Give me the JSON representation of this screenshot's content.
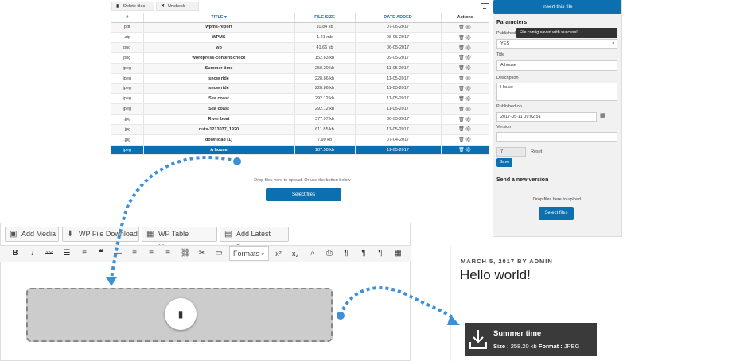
{
  "toolbar": {
    "delete_label": "Delete files",
    "uncheck_label": "Uncheck"
  },
  "table": {
    "headers": [
      "#",
      "TITLE ▾",
      "FILE SIZE",
      "DATE ADDED",
      "Actions"
    ],
    "rows": [
      {
        "ext": "pdf",
        "title": "wpms-report",
        "size": "10.84 kb",
        "date": "07-06-2017"
      },
      {
        "ext": ".zip",
        "title": "WPMS",
        "size": "1.21 mb",
        "date": "08-05-2017"
      },
      {
        "ext": "png",
        "title": "wp",
        "size": "41.66 kb",
        "date": "06-05-2017"
      },
      {
        "ext": "png",
        "title": "wordpress-content-check",
        "size": "152.63 kb",
        "date": "09-05-2017"
      },
      {
        "ext": "jpeg",
        "title": "Summer time",
        "size": "258.20 kb",
        "date": "11-05-2017"
      },
      {
        "ext": "jpeg",
        "title": "snow ride",
        "size": "228.86 kb",
        "date": "11-05-2017"
      },
      {
        "ext": "jpeg",
        "title": "snow ride",
        "size": "228.86 kb",
        "date": "11-05-2017"
      },
      {
        "ext": "jpeg",
        "title": "Sea coast",
        "size": "292.12 kb",
        "date": "11-05-2017"
      },
      {
        "ext": "jpeg",
        "title": "Sea coast",
        "size": "292.12 kb",
        "date": "11-05-2017"
      },
      {
        "ext": ".jpg",
        "title": "River boat",
        "size": "377.97 kb",
        "date": "30-05-2017"
      },
      {
        "ext": ".jpg",
        "title": "nuts-1213037_1920",
        "size": "611.85 kb",
        "date": "11-05-2017"
      },
      {
        "ext": ".jpg",
        "title": "download (1)",
        "size": "7.90 kb",
        "date": "07-04-2017"
      },
      {
        "ext": "jpeg",
        "title": "A house",
        "size": "187.50 kb",
        "date": "11-05-2017",
        "selected": true
      }
    ],
    "action_icons": "🗑⚙"
  },
  "upload": {
    "hint": "Drop files here to upload. Or use the button below",
    "button": "Select files"
  },
  "panel": {
    "insert_button": "Insert this file",
    "heading": "Parameters",
    "published_label": "Published",
    "published_value": "YES",
    "tooltip": "File config saved with success!",
    "title_label": "Title",
    "title_value": "A house",
    "description_label": "Description",
    "description_value": "House",
    "published_on_label": "Published on",
    "published_on_value": "2017-05-11 09:02:51",
    "version_label": "Version",
    "version_value": "",
    "hits_value": "7",
    "reset_label": "Reset",
    "save_label": "Save",
    "new_version_heading": "Send a new version",
    "new_version_hint": "Drop files here to upload",
    "new_version_button": "Select files"
  },
  "editor": {
    "buttons": [
      "Add Media",
      "WP File Download",
      "WP Table Manager",
      "Add Latest Posts"
    ],
    "formats_label": "Formats"
  },
  "blog": {
    "meta": "MARCH 5, 2017 BY ADMIN",
    "title": "Hello world!",
    "download_name": "Summer time",
    "download_size_label": "Size :",
    "download_size": "258.20 kb",
    "download_format_label": "Format :",
    "download_format": "JPEG"
  },
  "colors": {
    "accent": "#0c6fb0",
    "arrow": "#3f8fd6",
    "download_bg": "#3a3a3a"
  }
}
